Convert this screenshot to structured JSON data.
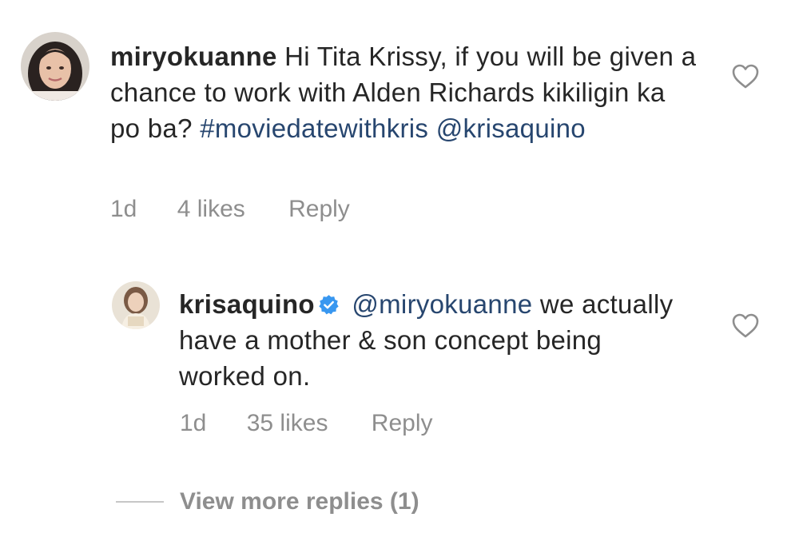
{
  "comments": [
    {
      "username": "miryokuanne",
      "text_plain": "Hi Tita Krissy, if you will be given a chance to work with Alden Richards kikiligin ka po ba?",
      "hashtag": "#moviedatewithkris",
      "mention": "@krisaquino",
      "time": "1d",
      "likes": "4 likes",
      "reply_label": "Reply",
      "avatar_icon": "user-avatar-photo",
      "like_icon": "heart-outline-icon"
    },
    {
      "username": "krisaquino",
      "verified": true,
      "verified_icon": "verified-badge-icon",
      "mention": "@miryokuanne",
      "text_plain": "we actually have a mother & son concept being worked on.",
      "time": "1d",
      "likes": "35 likes",
      "reply_label": "Reply",
      "avatar_icon": "user-avatar-photo",
      "like_icon": "heart-outline-icon"
    }
  ],
  "view_more_replies": "View more replies (1)",
  "colors": {
    "text": "#262626",
    "muted": "#8e8e8e",
    "link": "#27466f",
    "verified": "#3897f0"
  }
}
